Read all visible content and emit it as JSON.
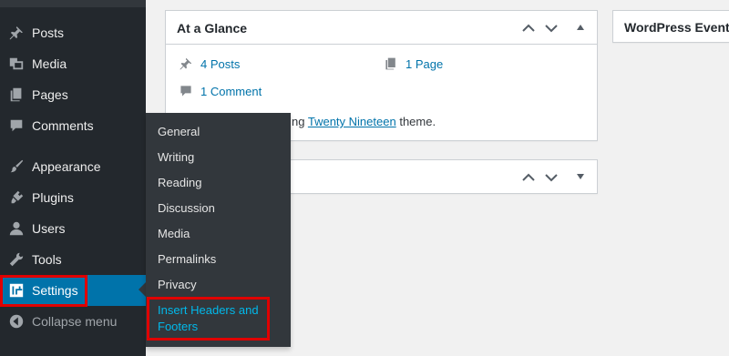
{
  "sidebar": {
    "items": [
      {
        "label": "Posts",
        "icon": "pushpin-icon"
      },
      {
        "label": "Media",
        "icon": "media-icon"
      },
      {
        "label": "Pages",
        "icon": "pages-icon"
      },
      {
        "label": "Comments",
        "icon": "comment-icon"
      },
      {
        "label": "Appearance",
        "icon": "paintbrush-icon"
      },
      {
        "label": "Plugins",
        "icon": "plugin-icon"
      },
      {
        "label": "Users",
        "icon": "users-icon"
      },
      {
        "label": "Tools",
        "icon": "wrench-icon"
      },
      {
        "label": "Settings",
        "icon": "settings-icon"
      },
      {
        "label": "Collapse menu",
        "icon": "collapse-icon"
      }
    ]
  },
  "flyout": {
    "items": [
      "General",
      "Writing",
      "Reading",
      "Discussion",
      "Media",
      "Permalinks",
      "Privacy"
    ],
    "current": "Insert Headers and Footers"
  },
  "at_a_glance": {
    "title": "At a Glance",
    "posts": "4 Posts",
    "pages": "1 Page",
    "comments": "1 Comment",
    "theme_prefix": "ng",
    "theme_name": "Twenty Nineteen",
    "theme_suffix": "theme."
  },
  "events": {
    "title": "WordPress Events"
  },
  "colors": {
    "sidebar_bg": "#23282d",
    "flyout_bg": "#32373c",
    "active_bg": "#0073aa",
    "link": "#0073aa",
    "current_submenu": "#00b9eb",
    "highlight": "#e00000"
  }
}
